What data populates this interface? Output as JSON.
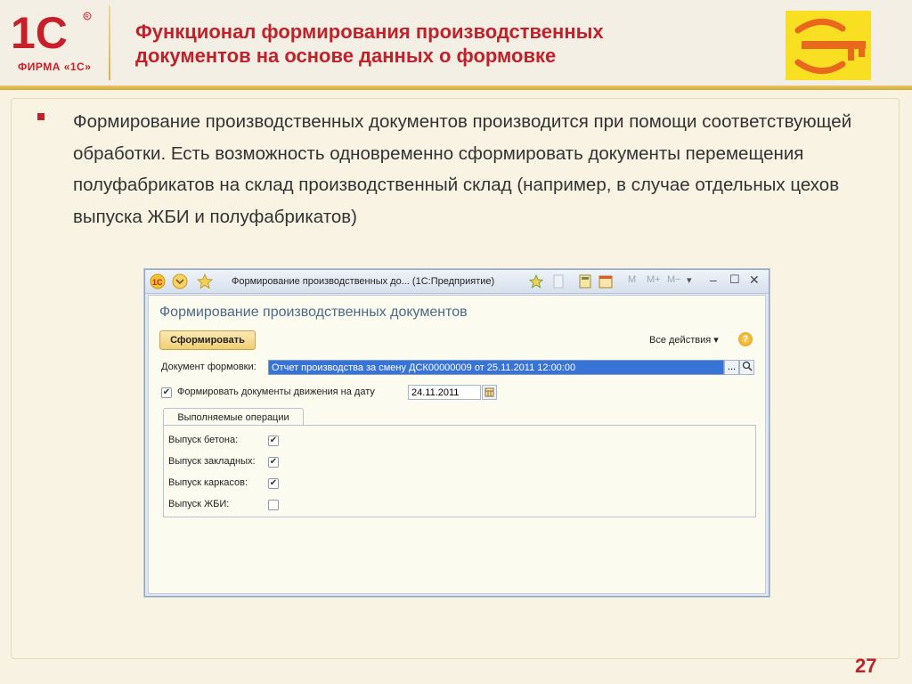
{
  "slide": {
    "title_line1": "Функционал формирования производственных",
    "title_line2": "документов на основе данных о формовке",
    "logo_text": "ФИРМА «1С»",
    "bullet": "Формирование производственных документов производится при помощи соответствующей обработки. Есть возможность одновременно сформировать документы перемещения полуфабрикатов на склад производственный склад (например, в случае отдельных цехов выпуска ЖБИ и полуфабрикатов)",
    "page_number": "27"
  },
  "window": {
    "title": "Формирование производственных до... (1С:Предприятие)",
    "toolbar_labels": [
      "M",
      "M+",
      "M−"
    ],
    "form_title": "Формирование производственных документов",
    "generate_button": "Сформировать",
    "all_actions": "Все действия ▾",
    "doc_label": "Документ формовки:",
    "doc_value": "Отчет производства за смену ДСК00000009 от 25.11.2011 12:00:00",
    "movement_label": "Формировать документы движения на дату",
    "movement_checked": true,
    "date_value": "24.11.2011",
    "tab_label": "Выполняемые операции",
    "operations": [
      {
        "label": "Выпуск бетона:",
        "checked": true
      },
      {
        "label": "Выпуск закладных:",
        "checked": true
      },
      {
        "label": "Выпуск каркасов:",
        "checked": true
      },
      {
        "label": "Выпуск ЖБИ:",
        "checked": false
      }
    ]
  },
  "colors": {
    "accent_red": "#c0222b",
    "key_logo_yellow": "#f8df22",
    "key_logo_orange": "#e8681e",
    "selection_blue": "#3874d6"
  }
}
